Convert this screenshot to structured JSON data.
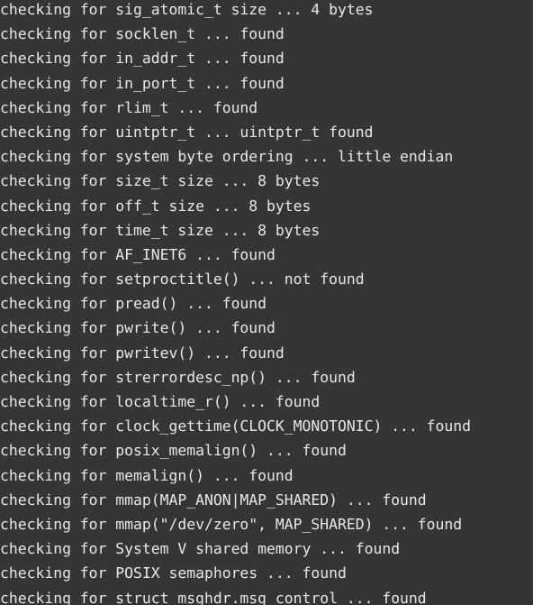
{
  "terminal": {
    "app": "terminal-console",
    "background_color": "#353535",
    "foreground_color": "#e8e8e3",
    "columns": 60,
    "rows": 24,
    "lines": [
      "checking for sig_atomic_t size ... 4 bytes",
      "checking for socklen_t ... found",
      "checking for in_addr_t ... found",
      "checking for in_port_t ... found",
      "checking for rlim_t ... found",
      "checking for uintptr_t ... uintptr_t found",
      "checking for system byte ordering ... little endian",
      "checking for size_t size ... 8 bytes",
      "checking for off_t size ... 8 bytes",
      "checking for time_t size ... 8 bytes",
      "checking for AF_INET6 ... found",
      "checking for setproctitle() ... not found",
      "checking for pread() ... found",
      "checking for pwrite() ... found",
      "checking for pwritev() ... found",
      "checking for strerrordesc_np() ... found",
      "checking for localtime_r() ... found",
      "checking for clock_gettime(CLOCK_MONOTONIC) ... found",
      "checking for posix_memalign() ... found",
      "checking for memalign() ... found",
      "checking for mmap(MAP_ANON|MAP_SHARED) ... found",
      "checking for mmap(\"/dev/zero\", MAP_SHARED) ... found",
      "checking for System V shared memory ... found",
      "checking for POSIX semaphores ... found",
      "checking for struct msghdr.msg_control ... found"
    ]
  }
}
